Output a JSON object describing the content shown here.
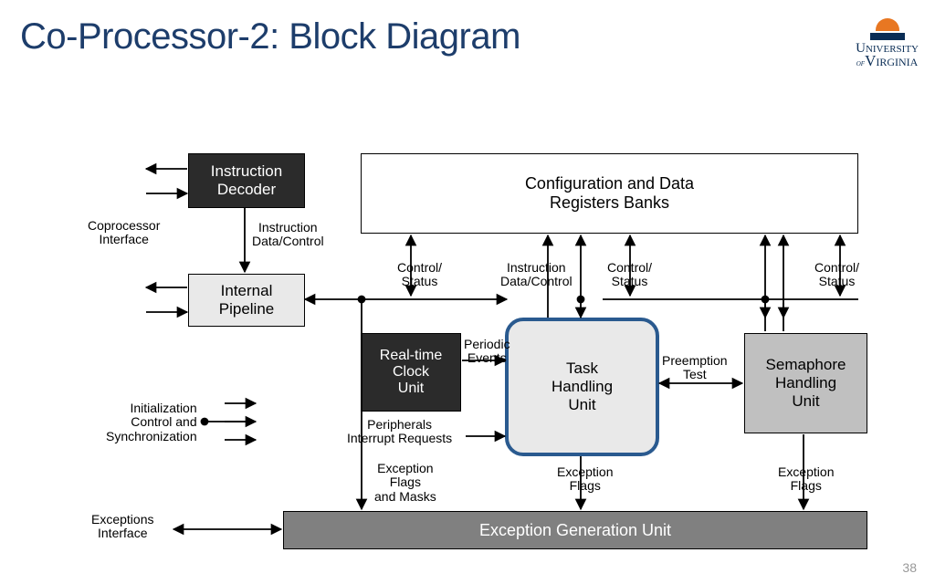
{
  "title": "Co-Processor-2: Block Diagram",
  "pagenum": "38",
  "logo": {
    "line1": "University",
    "of": "of",
    "line2": "Virginia"
  },
  "blocks": {
    "instruction_decoder": "Instruction\nDecoder",
    "internal_pipeline": "Internal\nPipeline",
    "config_registers": "Configuration and Data\nRegisters Banks",
    "rtc": "Real-time\nClock\nUnit",
    "task_handling": "Task\nHandling\nUnit",
    "semaphore_handling": "Semaphore\nHandling\nUnit",
    "exception_gen": "Exception Generation Unit"
  },
  "labels": {
    "coprocessor_interface": "Coprocessor\nInterface",
    "instruction_data_control_1": "Instruction\nData/Control",
    "control_status_1": "Control/\nStatus",
    "instruction_data_control_2": "Instruction\nData/Control",
    "control_status_2": "Control/\nStatus",
    "control_status_3": "Control/\nStatus",
    "periodic_events": "Periodic\nEvents",
    "preemption_test": "Preemption\nTest",
    "peripherals_irq": "Peripherals\nInterrupt Requests",
    "initialization": "Initialization\nControl and\nSynchronization",
    "exception_flags_masks": "Exception\nFlags\nand Masks",
    "exception_flags_1": "Exception\nFlags",
    "exception_flags_2": "Exception\nFlags",
    "exceptions_interface": "Exceptions\nInterface"
  }
}
